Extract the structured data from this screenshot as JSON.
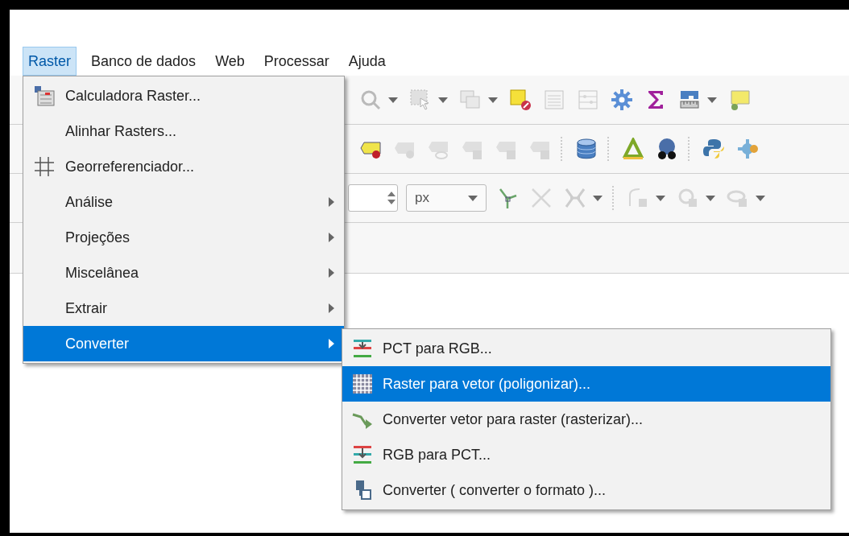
{
  "menubar": [
    {
      "label": "Raster",
      "selected": true
    },
    {
      "label": "Banco de dados",
      "selected": false
    },
    {
      "label": "Web",
      "selected": false
    },
    {
      "label": "Processar",
      "selected": false
    },
    {
      "label": "Ajuda",
      "selected": false
    }
  ],
  "toolbars": [
    {
      "tools": [
        {
          "kind": "tool",
          "disabled": true,
          "dropdown": true
        },
        {
          "kind": "tool",
          "disabled": true,
          "dropdown": true
        },
        {
          "kind": "tool",
          "disabled": true,
          "dropdown": true
        },
        {
          "kind": "tool",
          "disabled": false,
          "dropdown": false
        },
        {
          "kind": "tool",
          "disabled": true,
          "dropdown": false
        },
        {
          "kind": "tool",
          "disabled": true,
          "dropdown": false
        },
        {
          "kind": "tool",
          "disabled": false,
          "dropdown": false
        },
        {
          "kind": "tool",
          "disabled": false,
          "dropdown": false
        },
        {
          "kind": "tool",
          "disabled": false,
          "dropdown": true
        },
        {
          "kind": "tool",
          "disabled": false,
          "dropdown": false
        }
      ]
    },
    {
      "tools": [
        {
          "kind": "tool",
          "disabled": false,
          "dropdown": false
        },
        {
          "kind": "tool",
          "disabled": true,
          "dropdown": false
        },
        {
          "kind": "tool",
          "disabled": true,
          "dropdown": false
        },
        {
          "kind": "tool",
          "disabled": true,
          "dropdown": false
        },
        {
          "kind": "tool",
          "disabled": true,
          "dropdown": false
        },
        {
          "kind": "tool",
          "disabled": true,
          "dropdown": false
        },
        {
          "kind": "separator"
        },
        {
          "kind": "tool",
          "disabled": false,
          "dropdown": false
        },
        {
          "kind": "separator"
        },
        {
          "kind": "tool",
          "disabled": false,
          "dropdown": false
        },
        {
          "kind": "tool",
          "disabled": false,
          "dropdown": false
        },
        {
          "kind": "separator"
        },
        {
          "kind": "tool",
          "disabled": false,
          "dropdown": false
        },
        {
          "kind": "tool",
          "disabled": false,
          "dropdown": false
        }
      ]
    },
    {
      "tools": [
        {
          "kind": "spinbox"
        },
        {
          "kind": "combo",
          "value": "px"
        },
        {
          "kind": "tool",
          "disabled": false,
          "dropdown": false
        },
        {
          "kind": "tool",
          "disabled": true,
          "dropdown": false
        },
        {
          "kind": "tool",
          "disabled": true,
          "dropdown": true
        },
        {
          "kind": "separator"
        },
        {
          "kind": "tool",
          "disabled": true,
          "dropdown": true
        },
        {
          "kind": "tool",
          "disabled": true,
          "dropdown": true
        },
        {
          "kind": "tool",
          "disabled": true,
          "dropdown": true
        }
      ]
    }
  ],
  "raster_menu": {
    "items": [
      {
        "label": "Calculadora Raster...",
        "has_submenu": false,
        "selected": false
      },
      {
        "label": "Alinhar Rasters...",
        "has_submenu": false,
        "selected": false
      },
      {
        "label": "Georreferenciador...",
        "has_submenu": false,
        "selected": false
      },
      {
        "label": "Análise",
        "has_submenu": true,
        "selected": false
      },
      {
        "label": "Projeções",
        "has_submenu": true,
        "selected": false
      },
      {
        "label": "Miscelânea",
        "has_submenu": true,
        "selected": false
      },
      {
        "label": "Extrair",
        "has_submenu": true,
        "selected": false
      },
      {
        "label": "Converter",
        "has_submenu": true,
        "selected": true
      }
    ]
  },
  "converter_submenu": {
    "items": [
      {
        "label": "PCT para RGB...",
        "selected": false
      },
      {
        "label": "Raster para vetor (poligonizar)...",
        "selected": true
      },
      {
        "label": "Converter vetor para raster (rasterizar)...",
        "selected": false
      },
      {
        "label": "RGB para PCT...",
        "selected": false
      },
      {
        "label": "Converter ( converter o formato )...",
        "selected": false
      }
    ]
  }
}
